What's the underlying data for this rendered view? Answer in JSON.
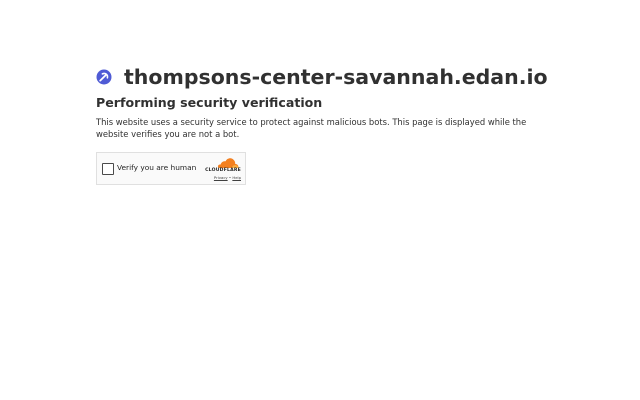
{
  "header": {
    "site_name": "thompsons-center-savannah.edan.io",
    "icon": "site-favicon-icon",
    "icon_color": "#4f5bd5"
  },
  "main": {
    "heading": "Performing security verification",
    "description": "This website uses a security service to protect against malicious bots. This page is displayed while the website verifies you are not a bot."
  },
  "widget": {
    "checkbox_label": "Verify you are human",
    "checked": false,
    "brand": "CLOUDFLARE",
    "brand_color": "#f38020",
    "privacy_label": "Privacy",
    "separator": "•",
    "help_label": "Help"
  }
}
